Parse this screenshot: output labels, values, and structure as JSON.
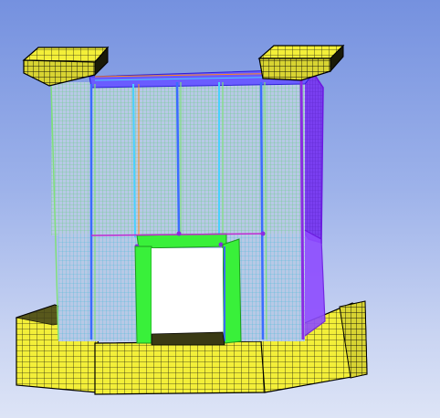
{
  "viewport": {
    "background_top": "#7591df",
    "background_bottom": "#dde4f6"
  },
  "colors": {
    "mesh_face": "#b8c9e6",
    "mesh_line_green": "#58d45a",
    "mesh_line_cyan": "#34c3e8",
    "mesh_line_blue": "#4a63ff",
    "mesh_line_purple": "#8a2be2",
    "mesh_line_orange": "#ff8a1a",
    "column_green": "#39f03a",
    "foundation_yellow": "#f3ef39",
    "foundation_dark": "#6f6f2a",
    "edge_black": "#000000"
  }
}
